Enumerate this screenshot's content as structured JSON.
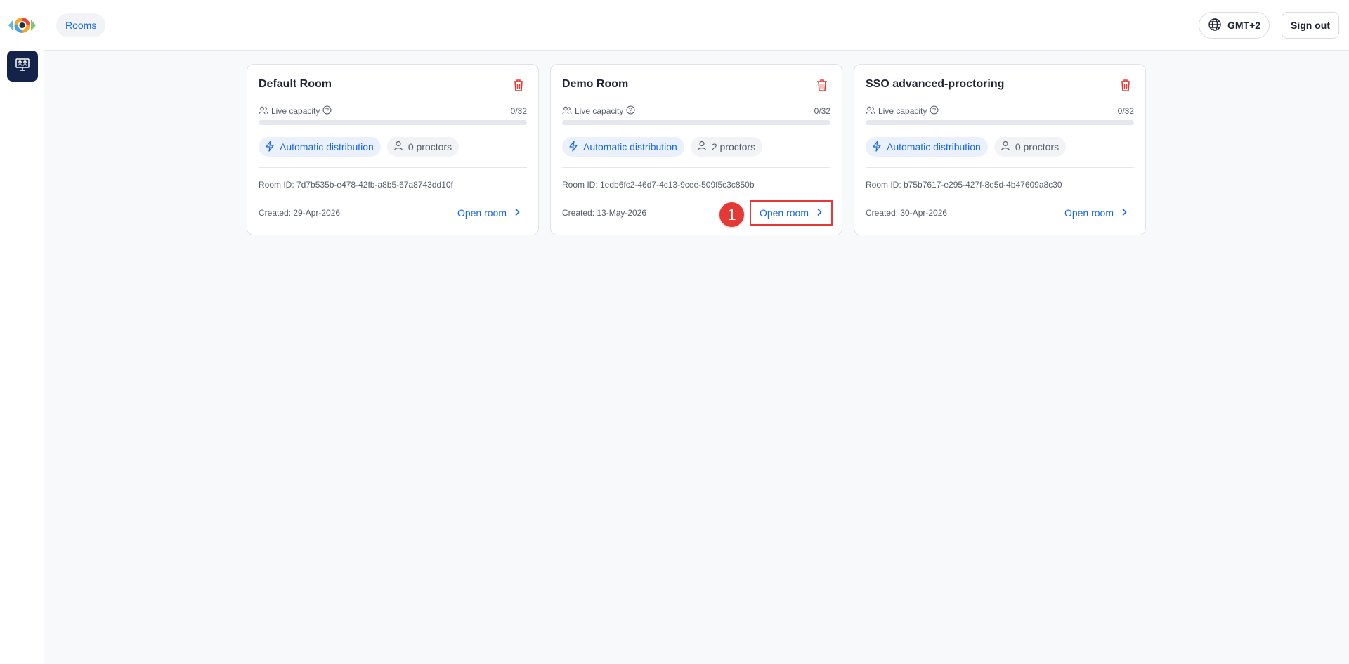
{
  "app": {
    "logo_icon": "eye-logo-icon",
    "accent_color": "#1769e0",
    "danger_color": "#e53935"
  },
  "topbar": {
    "tab_label": "Rooms",
    "timezone_label": "GMT+2",
    "signout_label": "Sign out"
  },
  "rooms": [
    {
      "title": "Default Room",
      "capacity_label": "Live capacity",
      "capacity_value": "0/32",
      "capacity_fraction": 0,
      "distribution_label": "Automatic distribution",
      "proctors_label": "0 proctors",
      "room_id": "Room ID: 7d7b535b-e478-42fb-a8b5-67a8743dd10f",
      "created": "Created: 29-Apr-2026",
      "open_label": "Open room"
    },
    {
      "title": "Demo Room",
      "capacity_label": "Live capacity",
      "capacity_value": "0/32",
      "capacity_fraction": 0,
      "distribution_label": "Automatic distribution",
      "proctors_label": "2 proctors",
      "room_id": "Room ID: 1edb6fc2-46d7-4c13-9cee-509f5c3c850b",
      "created": "Created: 13-May-2026",
      "open_label": "Open room"
    },
    {
      "title": "SSO advanced-proctoring",
      "capacity_label": "Live capacity",
      "capacity_value": "0/32",
      "capacity_fraction": 0,
      "distribution_label": "Automatic distribution",
      "proctors_label": "0 proctors",
      "room_id": "Room ID: b75b7617-e295-427f-8e5d-4b47609a8c30",
      "created": "Created: 30-Apr-2026",
      "open_label": "Open room"
    }
  ],
  "annotation": {
    "marker_label": "1"
  }
}
